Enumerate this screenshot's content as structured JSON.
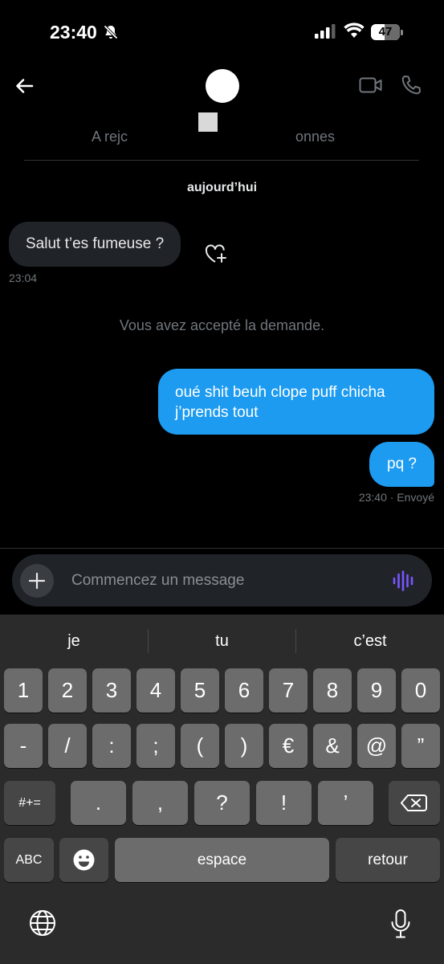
{
  "status_bar": {
    "time": "23:40",
    "battery_level": "47",
    "battery_fraction": 0.47,
    "icons": [
      "bell-off-icon",
      "cellular-signal-icon",
      "wifi-icon",
      "battery-icon"
    ]
  },
  "header": {
    "tabs": [
      "A rejc",
      "onnes"
    ],
    "icons": [
      "arrow-left-icon",
      "video-camera-icon",
      "phone-icon"
    ]
  },
  "conversation": {
    "date_label": "aujourd’hui",
    "incoming": {
      "text": "Salut t’es fumeuse ?",
      "time": "23:04"
    },
    "system_message": "Vous avez accepté la demande.",
    "outgoing": [
      {
        "text": "oué shit beuh clope puff chicha j’prends tout"
      },
      {
        "text": "pq ?"
      }
    ],
    "outgoing_status": "23:40 · Envoyé"
  },
  "composer": {
    "placeholder": "Commencez un message",
    "icons": [
      "plus-icon",
      "voice-waveform-icon"
    ]
  },
  "keyboard": {
    "suggestions": [
      "je",
      "tu",
      "c’est"
    ],
    "row1": [
      "1",
      "2",
      "3",
      "4",
      "5",
      "6",
      "7",
      "8",
      "9",
      "0"
    ],
    "row2": [
      "-",
      "/",
      ":",
      ";",
      "(",
      ")",
      "€",
      "&",
      "@",
      "”"
    ],
    "row3": [
      ".",
      ",",
      "?",
      "!",
      "’"
    ],
    "symbols_key": "#+=",
    "abc_key": "ABC",
    "space_key": "espace",
    "return_key": "retour",
    "icons": [
      "backspace-icon",
      "emoji-icon",
      "globe-icon",
      "microphone-icon"
    ]
  },
  "colors": {
    "accent_blue": "#1d9bf0",
    "background": "#000000",
    "incoming_bubble": "#202327",
    "voice_purple": "#7856ff"
  }
}
